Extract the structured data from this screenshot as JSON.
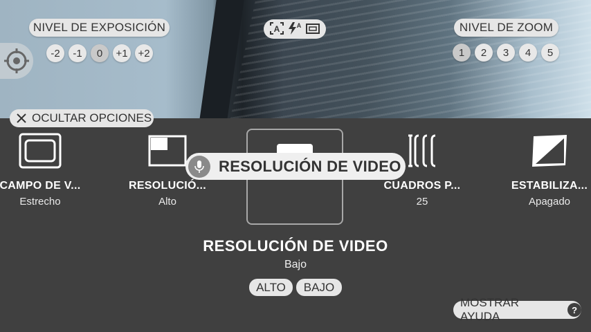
{
  "exposure": {
    "label": "NIVEL DE EXPOSICIÓN",
    "values": [
      "-2",
      "-1",
      "0",
      "+1",
      "+2"
    ],
    "selected": "0"
  },
  "modes": {
    "icons": [
      "auto-scene-icon",
      "flash-auto-icon",
      "aspect-icon"
    ],
    "flash_letter": "A"
  },
  "zoom": {
    "label": "NIVEL DE ZOOM",
    "values": [
      "1",
      "2",
      "3",
      "4",
      "5"
    ],
    "selected": "1"
  },
  "hide_options": {
    "label": "OCULTAR OPCIONES"
  },
  "options": [
    {
      "title": "CAMPO DE V...",
      "value": "Estrecho",
      "icon": "field-of-view-icon"
    },
    {
      "title": "RESOLUCIÓ...",
      "value": "Alto",
      "icon": "photo-resolution-icon"
    },
    {
      "title": "RESOLUCIÓN DE VIDEO",
      "value": "Bajo",
      "icon": "video-resolution-icon"
    },
    {
      "title": "CUADROS P...",
      "value": "25",
      "icon": "frame-rate-icon"
    },
    {
      "title": "ESTABILIZA...",
      "value": "Apagado",
      "icon": "stabilization-icon"
    }
  ],
  "tooltip": {
    "text": "RESOLUCIÓN DE VIDEO"
  },
  "detail": {
    "title": "RESOLUCIÓN DE VIDEO",
    "value": "Bajo",
    "choices": [
      "ALTO",
      "BAJO"
    ]
  },
  "help": {
    "label": "MOSTRAR AYUDA",
    "icon_text": "?"
  }
}
